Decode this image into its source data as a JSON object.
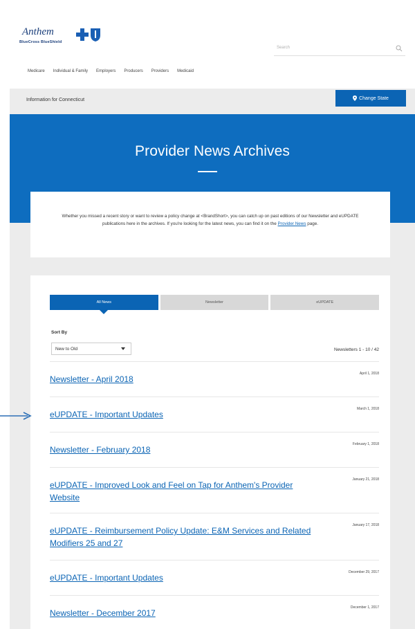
{
  "header": {
    "logo_word": "Anthem",
    "logo_sub": "BlueCross BlueShield",
    "search_placeholder": "Search",
    "nav": [
      "Medicare",
      "Individual & Family",
      "Employers",
      "Producers",
      "Providers",
      "Medicaid"
    ]
  },
  "state_bar": {
    "info": "Information for Connecticut",
    "button_label": "Change State"
  },
  "hero": {
    "title": "Provider News Archives"
  },
  "intro": {
    "text_before": "Whether you missed a recent story or want to review a policy change at <BrandShort>, you can catch up on past editions of our Newsletter and eUPDATE publications here in the archives. If you're looking for the latest news, you can find it on the ",
    "link_label": "Provider News",
    "text_after": " page."
  },
  "tabs": [
    "All News",
    "Newsletter",
    "eUPDATE"
  ],
  "sort": {
    "label": "Sort By",
    "value": "New to Old"
  },
  "count": "Newsletters 1 - 10 / 42",
  "articles": [
    {
      "title": "Newsletter - April 2018",
      "date": "April 1, 2018"
    },
    {
      "title": "eUPDATE - Important Updates",
      "date": "March 1, 2018"
    },
    {
      "title": "Newsletter - February 2018",
      "date": "February 1, 2018"
    },
    {
      "title": "eUPDATE - Improved Look and Feel on Tap for Anthem's Provider Website",
      "date": "January 21, 2018"
    },
    {
      "title": "eUPDATE - Reimbursement Policy Update: E&M Services and Related Modifiers 25 and 27",
      "date": "January 17, 2018"
    },
    {
      "title": "eUPDATE - Important Updates",
      "date": "December 29, 2017"
    },
    {
      "title": "Newsletter - December 2017",
      "date": "December 1, 2017"
    }
  ],
  "colors": {
    "brand_blue": "#0b64b4",
    "hero_blue": "#0e6dbf",
    "grey_bg": "#ececec"
  }
}
